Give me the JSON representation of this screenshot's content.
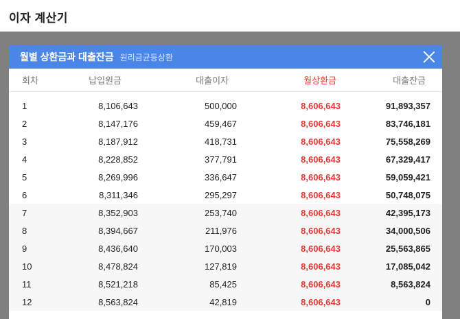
{
  "page": {
    "title": "이자 계산기"
  },
  "modal": {
    "title": "월별 상환금과 대출잔금",
    "subtitle": "원리금균등상환",
    "close_icon": "close-icon"
  },
  "table": {
    "headers": [
      "회차",
      "납입원금",
      "대출이자",
      "월상환금",
      "대출잔금"
    ],
    "rows": [
      [
        "1",
        "8,106,643",
        "500,000",
        "8,606,643",
        "91,893,357"
      ],
      [
        "2",
        "8,147,176",
        "459,467",
        "8,606,643",
        "83,746,181"
      ],
      [
        "3",
        "8,187,912",
        "418,731",
        "8,606,643",
        "75,558,269"
      ],
      [
        "4",
        "8,228,852",
        "377,791",
        "8,606,643",
        "67,329,417"
      ],
      [
        "5",
        "8,269,996",
        "336,647",
        "8,606,643",
        "59,059,421"
      ],
      [
        "6",
        "8,311,346",
        "295,297",
        "8,606,643",
        "50,748,075"
      ],
      [
        "7",
        "8,352,903",
        "253,740",
        "8,606,643",
        "42,395,173"
      ],
      [
        "8",
        "8,394,667",
        "211,976",
        "8,606,643",
        "34,000,506"
      ],
      [
        "9",
        "8,436,640",
        "170,003",
        "8,606,643",
        "25,563,865"
      ],
      [
        "10",
        "8,478,824",
        "127,819",
        "8,606,643",
        "17,085,042"
      ],
      [
        "11",
        "8,521,218",
        "85,425",
        "8,606,643",
        "8,563,824"
      ],
      [
        "12",
        "8,563,824",
        "42,819",
        "8,606,643",
        "0"
      ]
    ]
  },
  "colors": {
    "header_bg": "#4a86e8",
    "accent_red": "#e53935",
    "overlay": "#808080"
  }
}
